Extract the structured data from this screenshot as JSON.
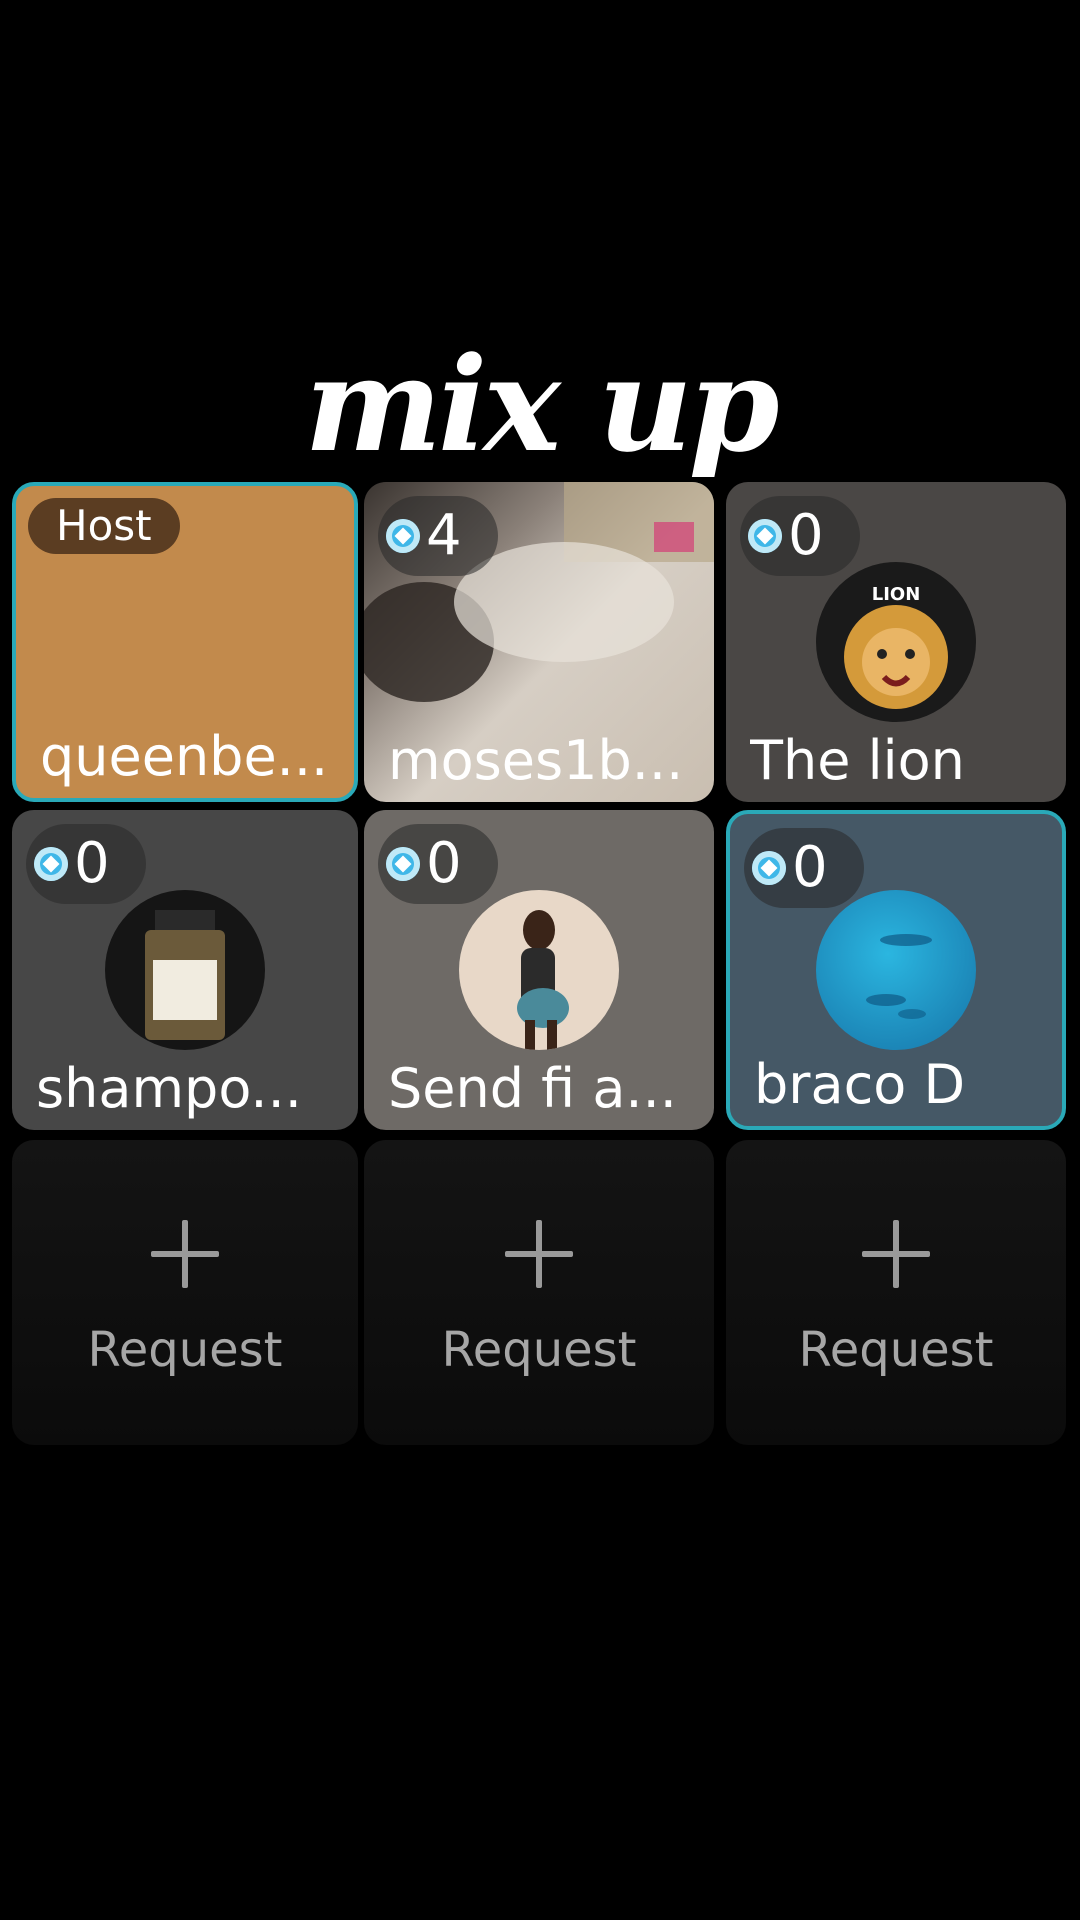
{
  "title": "mix up",
  "accent_color": "#2aa9b8",
  "host_tile": {
    "badge": "Host",
    "name": "queenbe...",
    "color": "#c28a4c"
  },
  "seats": [
    {
      "count": "4",
      "name": "moses1b...",
      "avatar": "video-frame"
    },
    {
      "count": "0",
      "name": "The lion",
      "avatar": "lion-logo"
    },
    {
      "count": "0",
      "name": "shampo...",
      "avatar": "perfume-bottle"
    },
    {
      "count": "0",
      "name": "Send  fi a...",
      "avatar": "person-photo"
    },
    {
      "count": "0",
      "name": "braco D",
      "avatar": "ocean-photo"
    }
  ],
  "requests": [
    {
      "label": "Request"
    },
    {
      "label": "Request"
    },
    {
      "label": "Request"
    }
  ]
}
